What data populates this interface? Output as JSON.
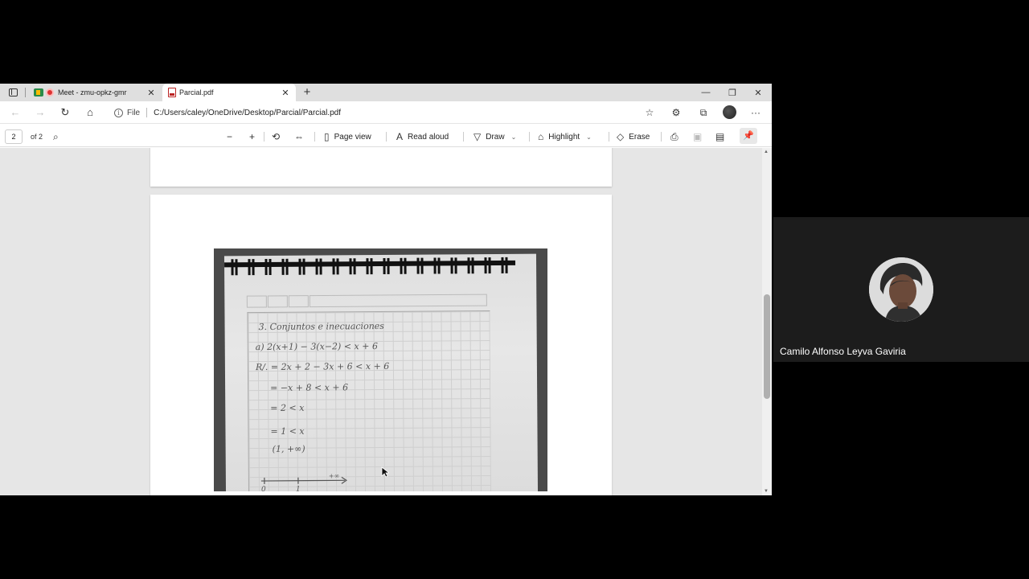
{
  "browser": {
    "tabs": [
      {
        "title": "Meet - zmu-opkz-gmr",
        "close": "✕"
      },
      {
        "title": "Parcial.pdf",
        "close": "✕"
      }
    ],
    "new_tab": "+",
    "window_controls": {
      "minimize": "—",
      "restore": "❐",
      "close": "✕"
    },
    "address": {
      "scheme_label": "File",
      "url": "C:/Users/caley/OneDrive/Desktop/Parcial/Parcial.pdf"
    }
  },
  "pdf_toolbar": {
    "page_current": "2",
    "page_total": "of 2",
    "page_view_label": "Page view",
    "read_aloud_label": "Read aloud",
    "draw_label": "Draw",
    "highlight_label": "Highlight",
    "erase_label": "Erase"
  },
  "handwriting": {
    "line1": "3. Conjuntos e inecuaciones",
    "line2": "a) 2(x+1) − 3(x−2) < x + 6",
    "line3": "R/. = 2x + 2 − 3x + 6 < x + 6",
    "line4": "= −x + 8 < x + 6",
    "line5": "= 2 < x",
    "line6": "= 1 < x",
    "line7": "(1, +∞)",
    "axis_inf": "+∞",
    "axis_0": "0",
    "axis_1": "1"
  },
  "participant": {
    "name": "Camilo Alfonso Leyva Gaviria"
  },
  "icons": [
    "tab-actions-icon",
    "recording-icon",
    "meet-icon",
    "pdf-icon",
    "back-icon",
    "forward-icon",
    "refresh-icon",
    "home-icon",
    "info-icon",
    "favorites-icon",
    "extensions-icon",
    "collections-icon",
    "profile-icon",
    "more-icon",
    "search-icon",
    "zoom-out-icon",
    "zoom-in-icon",
    "rotate-icon",
    "fit-icon",
    "page-view-icon",
    "read-aloud-icon",
    "draw-icon",
    "highlight-icon",
    "erase-icon",
    "print-icon",
    "save-icon",
    "save-as-icon",
    "pin-icon"
  ]
}
